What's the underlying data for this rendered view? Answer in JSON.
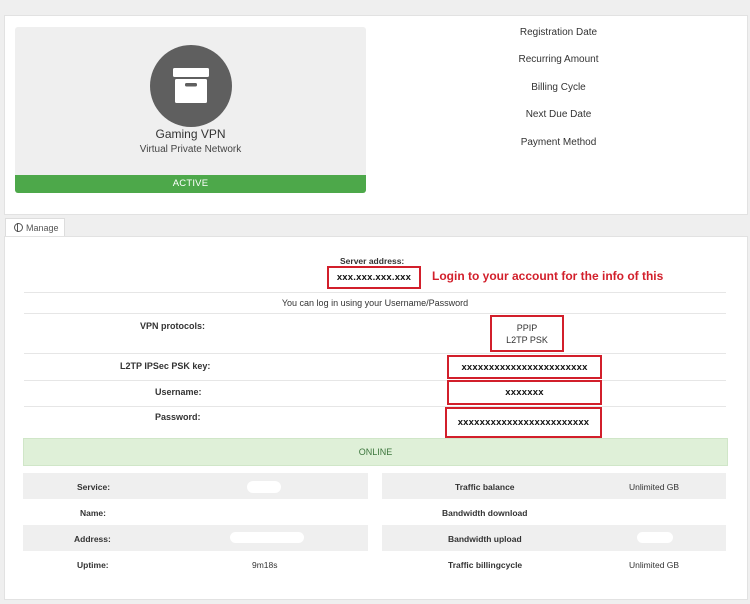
{
  "product": {
    "icon": "archive-box-icon",
    "name": "Gaming VPN",
    "subtitle": "Virtual Private Network",
    "status": "ACTIVE"
  },
  "details": {
    "registration_date_label": "Registration Date",
    "recurring_amount_label": "Recurring Amount",
    "billing_cycle_label": "Billing Cycle",
    "next_due_date_label": "Next Due Date",
    "payment_method_label": "Payment Method"
  },
  "tabs": {
    "manage_label": "Manage"
  },
  "manage": {
    "server_address_label": "Server address:",
    "server_address_value": "xxx.xxx.xxx.xxx",
    "annotation": "Login to your account for the info of this",
    "login_note": "You can log in using your Username/Password",
    "vpn_protocols_label": "VPN protocols:",
    "vpn_protocols": [
      "PPIP",
      "L2TP PSK"
    ],
    "psk_key_label": "L2TP IPSec PSK key:",
    "psk_key_value": "xxxxxxxxxxxxxxxxxxxxxxx",
    "username_label": "Username:",
    "username_value": "xxxxxxx",
    "password_label": "Password:",
    "password_value": "xxxxxxxxxxxxxxxxxxxxxxxx",
    "online_status": "ONLINE"
  },
  "stats": {
    "left": [
      {
        "label": "Service:",
        "value": ""
      },
      {
        "label": "Name:",
        "value": ""
      },
      {
        "label": "Address:",
        "value": ""
      },
      {
        "label": "Uptime:",
        "value": "9m18s"
      }
    ],
    "right": [
      {
        "label": "Traffic balance",
        "value": "Unlimited GB"
      },
      {
        "label": "Bandwidth download",
        "value": ""
      },
      {
        "label": "Bandwidth upload",
        "value": ""
      },
      {
        "label": "Traffic billingcycle",
        "value": "Unlimited GB"
      }
    ]
  },
  "colors": {
    "active_green": "#4da84a",
    "annotation_red": "#d21f2b",
    "online_bg": "#dff0d8"
  }
}
